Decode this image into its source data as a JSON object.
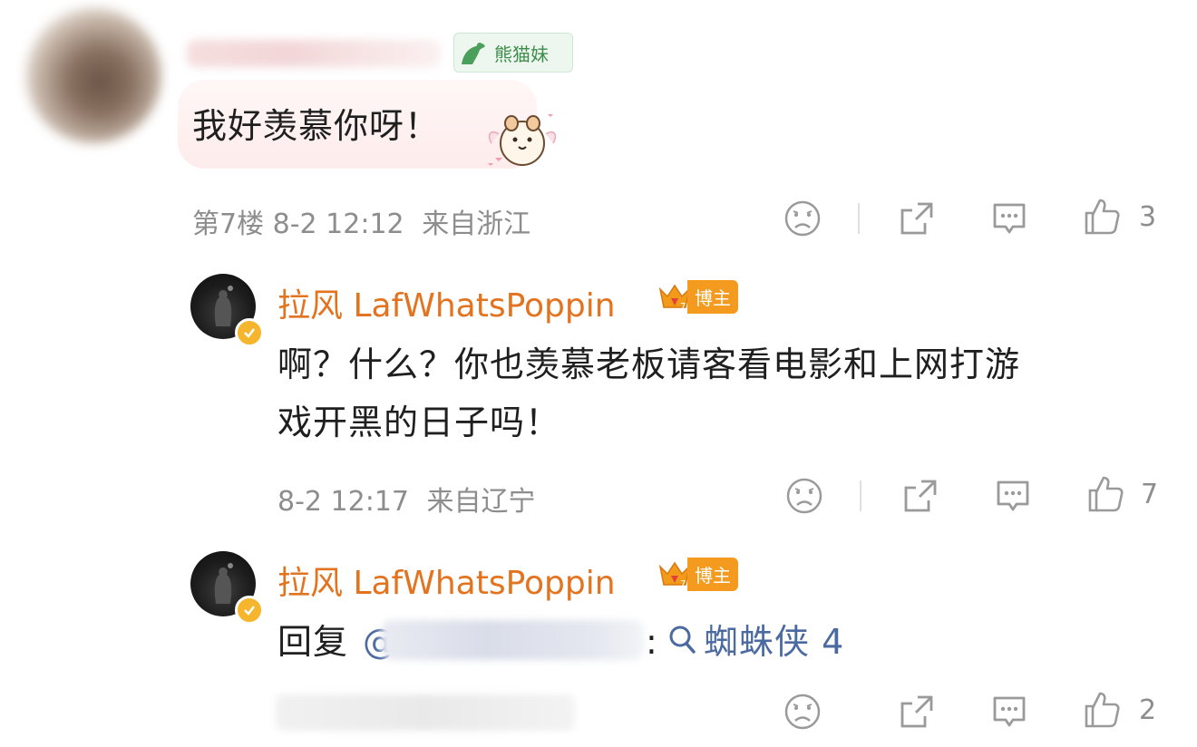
{
  "comment": {
    "user_badge": "熊猫妹",
    "text": "我好羡慕你呀！",
    "floor": "第7楼",
    "date": "8-2 12:12",
    "location": "来自浙江",
    "likes": "3"
  },
  "replies": [
    {
      "username": "拉风 LafWhatsPoppin",
      "badge": "博主",
      "text_line1": "啊？什么？你也羡慕老板请客看电影和上网打游",
      "text_line2": "戏开黑的日子吗！",
      "date": "8-2 12:17",
      "location": "来自辽宁",
      "likes": "7"
    },
    {
      "username": "拉风 LafWhatsPoppin",
      "badge": "博主",
      "reply_prefix": "回复",
      "at_symbol": "@",
      "colon": ":",
      "search_term": "蜘蛛侠 4",
      "likes": "2"
    }
  ],
  "icons": [
    "dislike-icon",
    "share-icon",
    "comment-icon",
    "like-icon"
  ],
  "colors": {
    "name": "#e3731f",
    "meta": "#8d8d8d",
    "link": "#4a6aa0",
    "badge_green": "#3d8e4a"
  }
}
